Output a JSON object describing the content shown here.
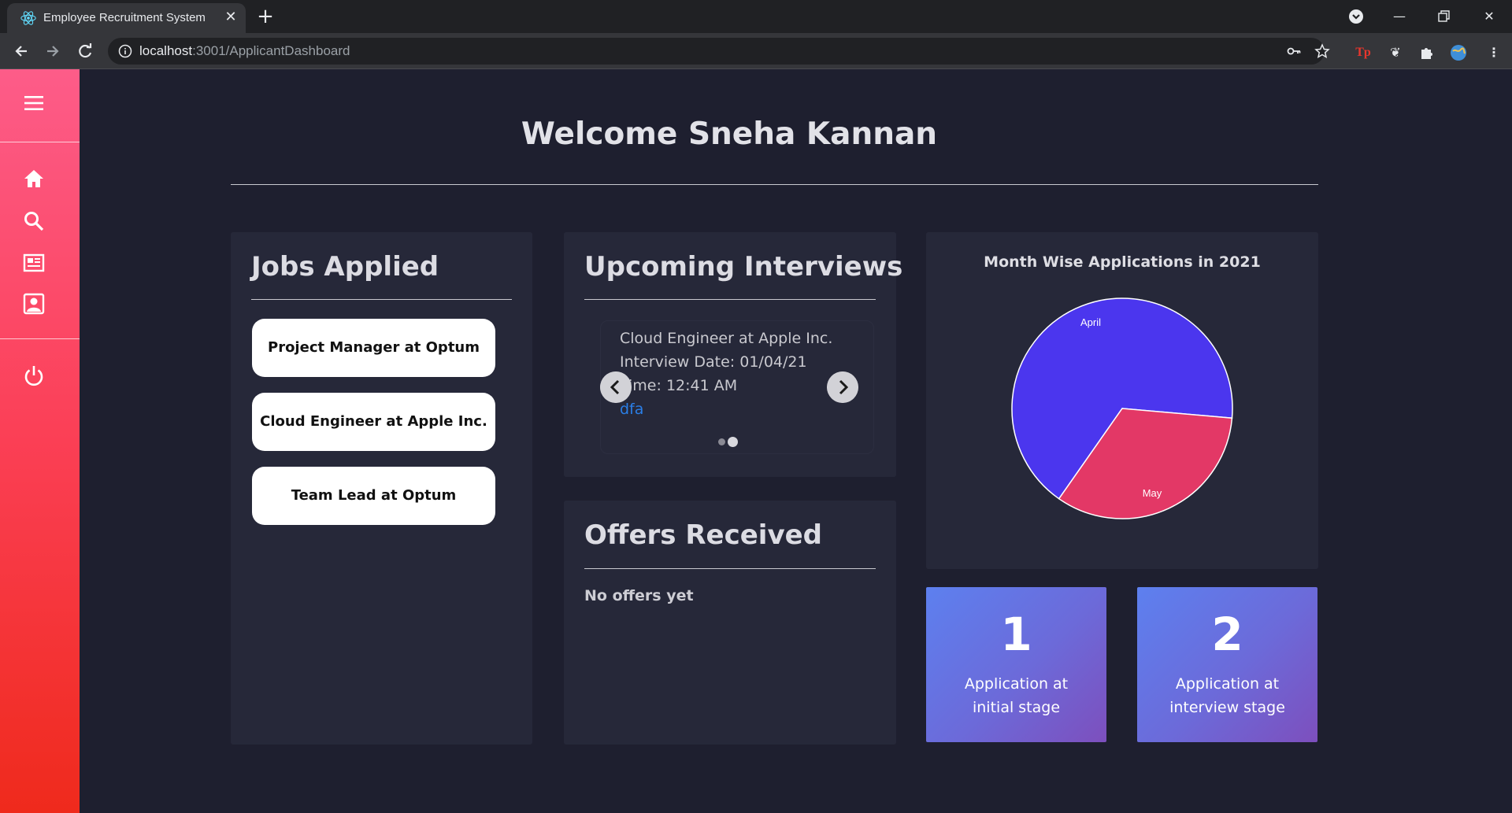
{
  "browser": {
    "tab_title": "Employee Recruitment System",
    "url_host": "localhost",
    "url_rest": ":3001/ApplicantDashboard"
  },
  "sidebar": {
    "icons": [
      "menu-icon",
      "home-icon",
      "search-icon",
      "newspaper-icon",
      "profile-icon",
      "power-icon"
    ]
  },
  "dashboard": {
    "welcome": "Welcome Sneha Kannan"
  },
  "jobs_applied": {
    "title": "Jobs Applied",
    "items": [
      "Project Manager at Optum",
      "Cloud Engineer at Apple Inc.",
      "Team Lead at Optum"
    ]
  },
  "upcoming_interviews": {
    "title": "Upcoming Interviews",
    "job": "Cloud Engineer at Apple Inc.",
    "date": "Interview Date:  01/04/21",
    "time": "Time:  12:41 AM",
    "link": "dfa"
  },
  "offers": {
    "title": "Offers Received",
    "empty_text": "No offers yet"
  },
  "chart_data": {
    "type": "pie",
    "title": "Month Wise Applications in 2021",
    "categories": [
      "April",
      "May"
    ],
    "values": [
      2,
      1
    ],
    "colors": [
      "#4b36ee",
      "#e33866"
    ]
  },
  "stats": [
    {
      "value": "1",
      "label_line1": "Application at",
      "label_line2": "initial stage"
    },
    {
      "value": "2",
      "label_line1": "Application at",
      "label_line2": "interview stage"
    }
  ]
}
